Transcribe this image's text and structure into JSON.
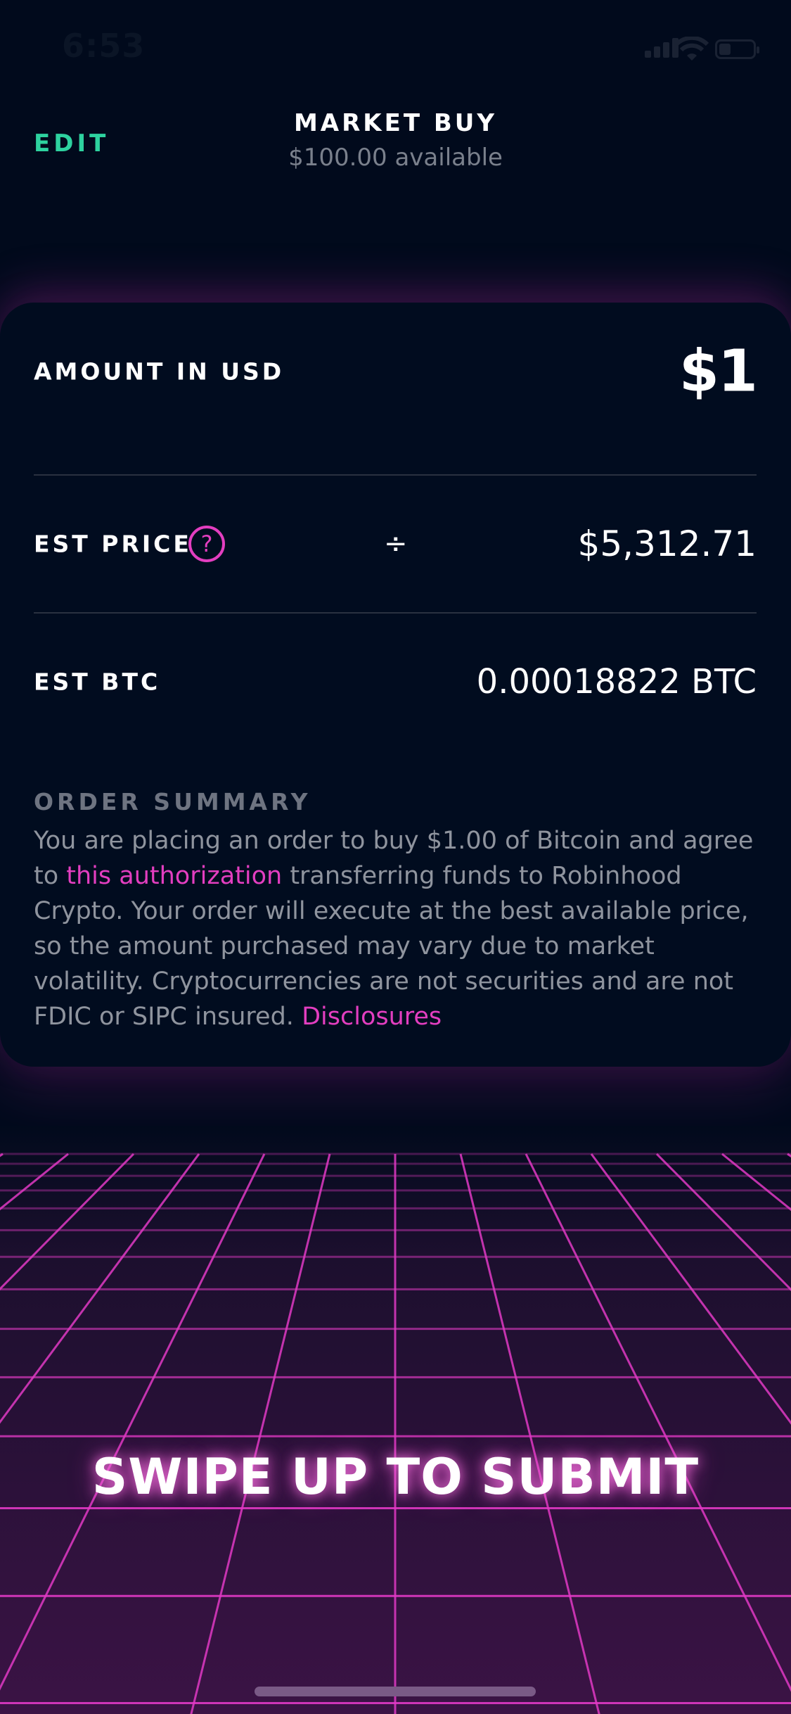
{
  "status_bar": {
    "time": "6:53",
    "icons": [
      "signal-icon",
      "wifi-icon",
      "battery-icon"
    ]
  },
  "header": {
    "edit_label": "EDIT",
    "title": "MARKET BUY",
    "subtitle": "$100.00 available"
  },
  "order": {
    "amount_label": "AMOUNT IN USD",
    "amount_value": "$1",
    "est_price_label": "EST PRICE",
    "help_icon_glyph": "?",
    "divide_glyph": "÷",
    "est_price_value": "$5,312.71",
    "est_btc_label": "EST BTC",
    "est_btc_value": "0.00018822 BTC"
  },
  "summary": {
    "title": "ORDER SUMMARY",
    "text_1": "You are placing an order to buy $1.00 of Bitcoin and agree to ",
    "link_1": "this authorization",
    "text_2": " transferring funds to Robinhood Crypto. Your order will execute at the best available price, so the amount purchased may vary due to market volatility. Cryptocurrencies are not securities and are not FDIC or SIPC insured. ",
    "link_2": "Disclosures"
  },
  "footer": {
    "swipe_label": "SWIPE UP TO SUBMIT"
  },
  "colors": {
    "background": "#010a1c",
    "accent_green": "#2ed29f",
    "accent_pink": "#e33ec0",
    "grid_line": "#e03ac4",
    "muted_text": "#8f949e"
  }
}
